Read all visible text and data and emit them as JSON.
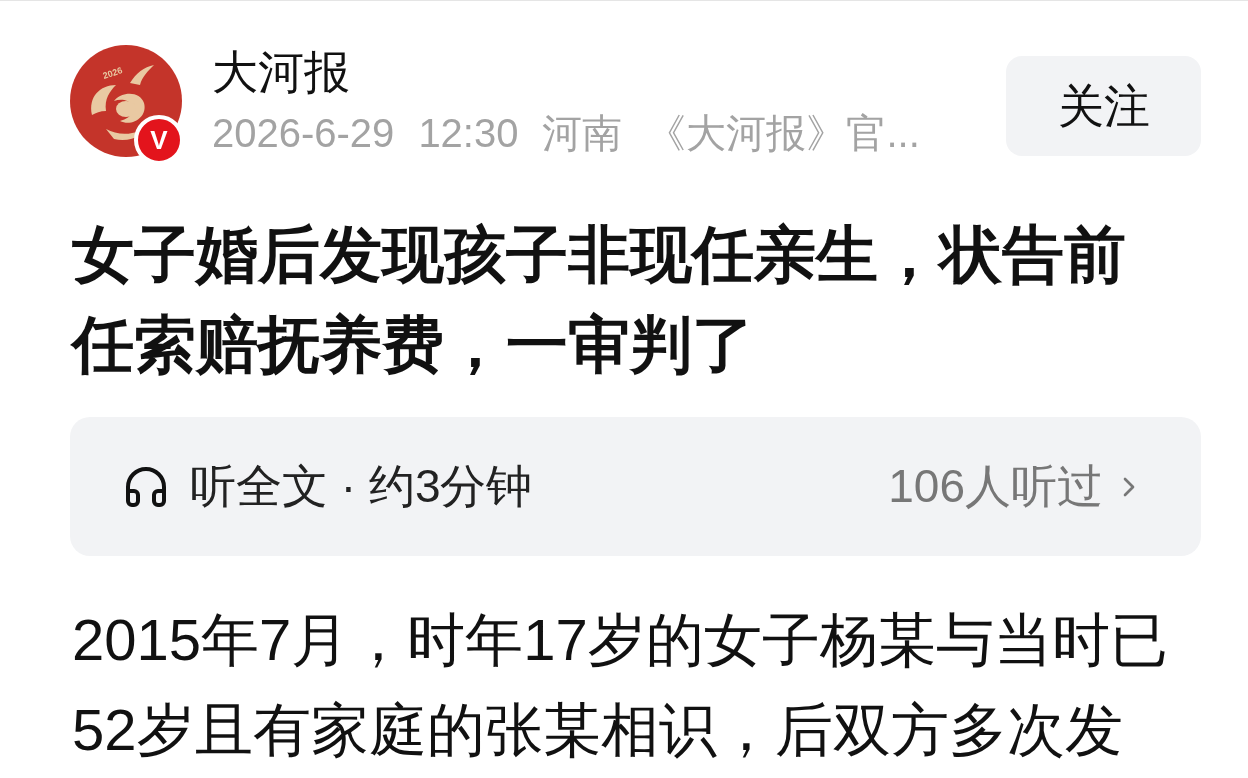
{
  "author": {
    "logo_text": "2026",
    "verified_badge": "V",
    "name": "大河报",
    "meta": [
      "2026-6-29",
      "12:30",
      "河南",
      "《大河报》官..."
    ]
  },
  "follow_button": {
    "label": "关注"
  },
  "title": "女子婚后发现孩子非现任亲生，状告前任索赔抚养费，一审判了",
  "audio_bar": {
    "label": "听全文 · 约3分钟",
    "listeners": "106人听过"
  },
  "body": "2015年7月，时年17岁的女子杨某与当时已52岁且有家庭的张某相识，后双方多次发"
}
